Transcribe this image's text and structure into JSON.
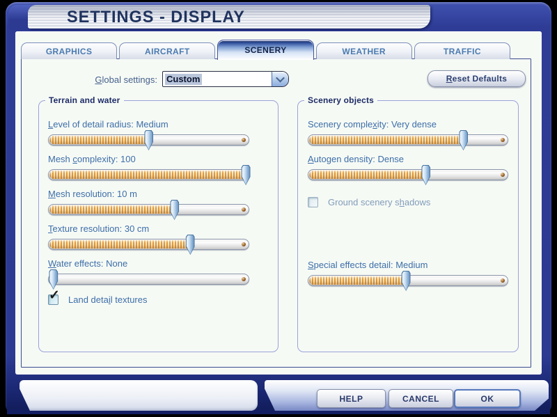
{
  "title": "SETTINGS - DISPLAY",
  "tabs": [
    {
      "label": "GRAPHICS",
      "active": false
    },
    {
      "label": "AIRCRAFT",
      "active": false
    },
    {
      "label": "SCENERY",
      "active": true
    },
    {
      "label": "WEATHER",
      "active": false
    },
    {
      "label": "TRAFFIC",
      "active": false
    }
  ],
  "global_settings": {
    "label": "Global settings:",
    "accel": "G",
    "value": "Custom"
  },
  "reset_defaults": {
    "label": "Reset Defaults",
    "accel": "R"
  },
  "terrain_group": {
    "title": "Terrain and water",
    "sliders": [
      {
        "label": "Level of detail radius: Medium",
        "accel": "L",
        "percent": 50
      },
      {
        "label": "Mesh complexity: 100",
        "accel": "c",
        "percent": 99
      },
      {
        "label": "Mesh resolution: 10 m",
        "accel": "M",
        "percent": 63
      },
      {
        "label": "Texture resolution: 30 cm",
        "accel": "T",
        "percent": 71
      },
      {
        "label": "Water effects: None",
        "accel": "W",
        "percent": 2
      }
    ],
    "checkbox": {
      "label": "Land detail textures",
      "accel": "i",
      "checked": true
    }
  },
  "scenery_group": {
    "title": "Scenery objects",
    "sliders": [
      {
        "label": "Scenery complexity: Very dense",
        "accel": "x",
        "percent": 78
      },
      {
        "label": "Autogen density: Dense",
        "accel": "A",
        "percent": 59
      }
    ],
    "checkbox": {
      "label": "Ground scenery shadows",
      "accel": "h",
      "checked": false,
      "disabled": true
    },
    "bottom_slider": {
      "label": "Special effects detail: Medium",
      "accel": "S",
      "percent": 49
    }
  },
  "footer": {
    "help": "HELP",
    "cancel": "CANCEL",
    "ok": "OK"
  },
  "icons": {
    "check": "✓",
    "dropdown": "chevron-down"
  },
  "colors": {
    "frame_blue": "#2e3c96",
    "accent_orange": "#e09a38",
    "label_blue": "#3d6ea8",
    "group_title_navy": "#1c2b66",
    "tab_text_blue": "#4a7ab0"
  }
}
